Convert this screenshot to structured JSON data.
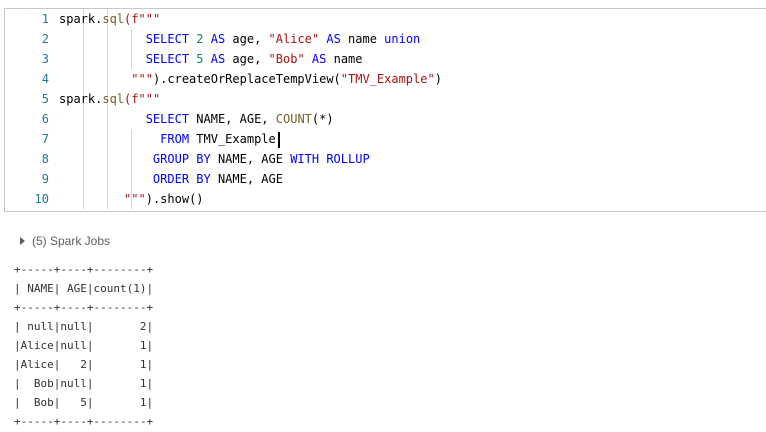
{
  "editor": {
    "line_numbers": [
      "1",
      "2",
      "3",
      "4",
      "5",
      "6",
      "7",
      "8",
      "9",
      "10"
    ],
    "lines": [
      [
        {
          "t": "spark.",
          "c": "tok-plain"
        },
        {
          "t": "sql",
          "c": "fn"
        },
        {
          "t": "(f\"\"\"",
          "c": "str"
        }
      ],
      [
        {
          "t": "            ",
          "c": "tok-plain"
        },
        {
          "t": "SELECT ",
          "c": "kw"
        },
        {
          "t": "2 ",
          "c": "num"
        },
        {
          "t": "AS ",
          "c": "kw"
        },
        {
          "t": "age, ",
          "c": "tok-plain"
        },
        {
          "t": "\"Alice\" ",
          "c": "str"
        },
        {
          "t": "AS ",
          "c": "kw"
        },
        {
          "t": "name ",
          "c": "tok-plain"
        },
        {
          "t": "union",
          "c": "kw"
        }
      ],
      [
        {
          "t": "            ",
          "c": "tok-plain"
        },
        {
          "t": "SELECT ",
          "c": "kw"
        },
        {
          "t": "5 ",
          "c": "num"
        },
        {
          "t": "AS ",
          "c": "kw"
        },
        {
          "t": "age, ",
          "c": "tok-plain"
        },
        {
          "t": "\"Bob\" ",
          "c": "str"
        },
        {
          "t": "AS ",
          "c": "kw"
        },
        {
          "t": "name",
          "c": "tok-plain"
        }
      ],
      [
        {
          "t": "          ",
          "c": "tok-plain"
        },
        {
          "t": "\"\"\"",
          "c": "str"
        },
        {
          "t": ").createOrReplaceTempView(",
          "c": "tok-plain"
        },
        {
          "t": "\"TMV_Example\"",
          "c": "str"
        },
        {
          "t": ")",
          "c": "tok-plain"
        }
      ],
      [
        {
          "t": "spark.",
          "c": "tok-plain"
        },
        {
          "t": "sql",
          "c": "fn"
        },
        {
          "t": "(f\"\"\"",
          "c": "str"
        }
      ],
      [
        {
          "t": "            ",
          "c": "tok-plain"
        },
        {
          "t": "SELECT ",
          "c": "kw"
        },
        {
          "t": "NAME, AGE, ",
          "c": "tok-plain"
        },
        {
          "t": "COUNT",
          "c": "fn"
        },
        {
          "t": "(*)",
          "c": "tok-plain"
        }
      ],
      [
        {
          "t": "              ",
          "c": "tok-plain"
        },
        {
          "t": "FROM ",
          "c": "kw"
        },
        {
          "t": "TMV_Example",
          "c": "tok-plain"
        }
      ],
      [
        {
          "t": "             ",
          "c": "tok-plain"
        },
        {
          "t": "GROUP BY ",
          "c": "kw"
        },
        {
          "t": "NAME, AGE ",
          "c": "tok-plain"
        },
        {
          "t": "WITH ROLLUP",
          "c": "kw"
        }
      ],
      [
        {
          "t": "             ",
          "c": "tok-plain"
        },
        {
          "t": "ORDER BY ",
          "c": "kw"
        },
        {
          "t": "NAME, AGE",
          "c": "tok-plain"
        }
      ],
      [
        {
          "t": "         ",
          "c": "tok-plain"
        },
        {
          "t": "\"\"\"",
          "c": "str"
        },
        {
          "t": ").show()",
          "c": "tok-plain"
        }
      ]
    ]
  },
  "jobs": {
    "label": "(5) Spark Jobs"
  },
  "output": {
    "lines": [
      "+-----+----+--------+",
      "| NAME| AGE|count(1)|",
      "+-----+----+--------+",
      "| null|null|       2|",
      "|Alice|null|       1|",
      "|Alice|   2|       1|",
      "|  Bob|null|       1|",
      "|  Bob|   5|       1|",
      "+-----+----+--------+"
    ]
  }
}
